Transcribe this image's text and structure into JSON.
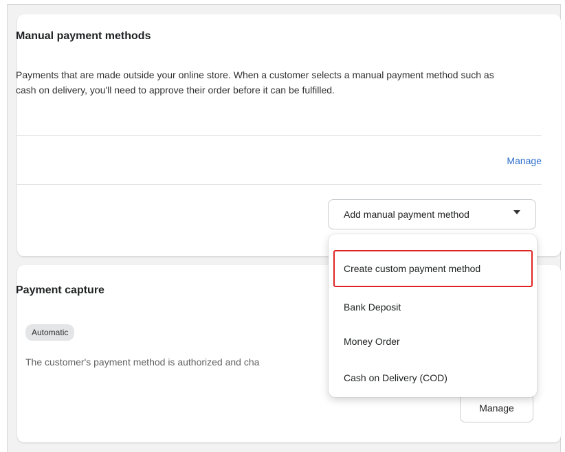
{
  "manual": {
    "title": "Manual payment methods",
    "description": "Payments that are made outside your online store. When a customer selects a manual payment method such as cash on delivery, you'll need to approve their order before it can be fulfilled.",
    "manage_label": "Manage",
    "add_button_label": "Add manual payment method"
  },
  "dropdown": {
    "items": [
      {
        "label": "Create custom payment method",
        "highlighted": true
      },
      {
        "label": "Bank Deposit"
      },
      {
        "label": "Money Order"
      },
      {
        "label": "Cash on Delivery (COD)"
      }
    ]
  },
  "capture": {
    "title": "Payment capture",
    "badge": "Automatic",
    "description": "The customer's payment method is authorized and cha",
    "manage_label": "Manage"
  },
  "colors": {
    "link": "#2c6ecb",
    "highlight_border": "#e02424"
  },
  "icons": {
    "add_button_caret": "caret-down-icon"
  }
}
